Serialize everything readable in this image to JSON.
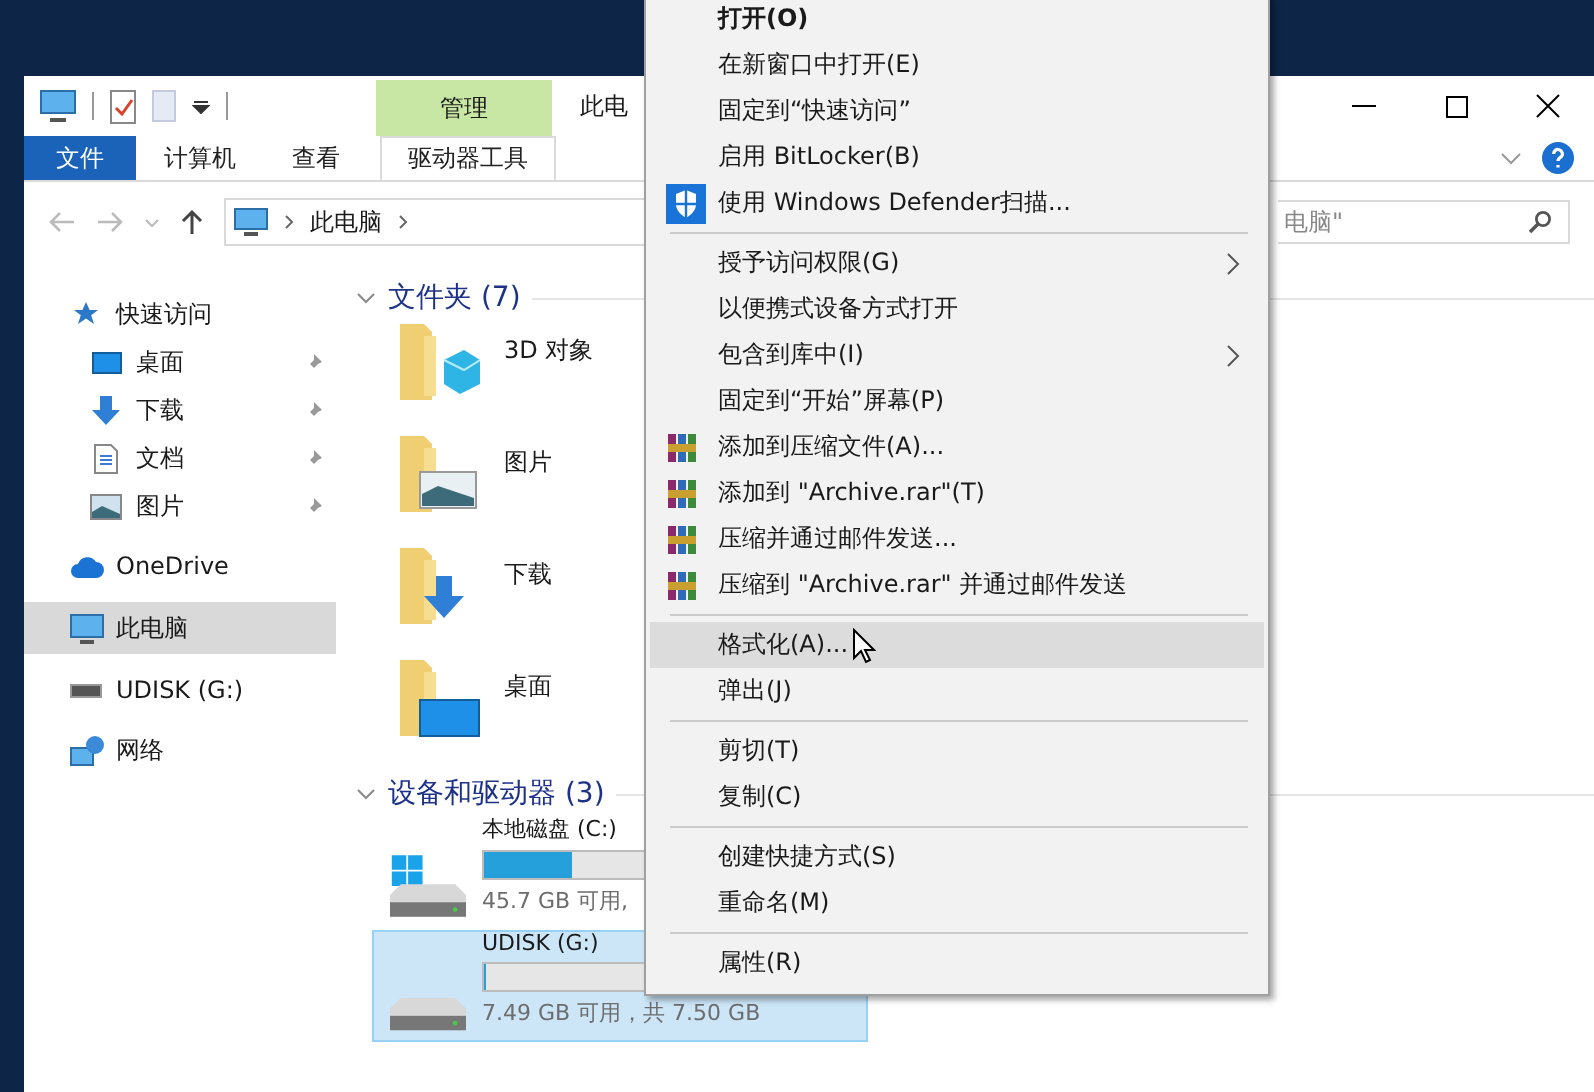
{
  "window": {
    "title": "此电",
    "context_tab": "管理"
  },
  "ribbon_tabs": [
    {
      "label": "文件",
      "kind": "file",
      "selected": false
    },
    {
      "label": "计算机",
      "kind": "tab",
      "selected": false
    },
    {
      "label": "查看",
      "kind": "tab",
      "selected": false
    },
    {
      "label": "驱动器工具",
      "kind": "context",
      "selected": false
    }
  ],
  "address_bar": {
    "path": [
      "此电脑"
    ]
  },
  "search": {
    "placeholder": "电脑\""
  },
  "sidebar": {
    "items": [
      {
        "label": "快速访问",
        "selected": false,
        "children": [
          {
            "label": "桌面",
            "pinned": true,
            "selected": false
          },
          {
            "label": "下载",
            "pinned": true,
            "selected": false
          },
          {
            "label": "文档",
            "pinned": true,
            "selected": false
          },
          {
            "label": "图片",
            "pinned": true,
            "selected": false
          }
        ]
      },
      {
        "label": "OneDrive",
        "selected": false
      },
      {
        "label": "此电脑",
        "selected": true
      },
      {
        "label": "UDISK (G:)",
        "selected": false
      },
      {
        "label": "网络",
        "selected": false
      }
    ]
  },
  "folders": {
    "header": "文件夹 (7)",
    "items": [
      {
        "label": "3D 对象"
      },
      {
        "label": "图片"
      },
      {
        "label": "下载"
      },
      {
        "label": "桌面"
      }
    ]
  },
  "drives": {
    "header": "设备和驱动器 (3)",
    "items": [
      {
        "label": "本地磁盘 (C:)",
        "level": 0.23,
        "info": "45.7 GB 可用,",
        "selected": false
      },
      {
        "label": "UDISK (G:)",
        "level": 0.0,
        "info": "7.49 GB 可用，共 7.50 GB",
        "selected": true
      }
    ]
  },
  "context_menu": {
    "items": [
      {
        "kind": "item",
        "label": "打开(O)",
        "default": true,
        "submenu": false,
        "highlighted": false
      },
      {
        "kind": "item",
        "label": "在新窗口中打开(E)",
        "default": false,
        "submenu": false,
        "highlighted": false
      },
      {
        "kind": "item",
        "label": "固定到“快速访问”",
        "default": false,
        "submenu": false,
        "highlighted": false
      },
      {
        "kind": "item",
        "label": "启用 BitLocker(B)",
        "default": false,
        "submenu": false,
        "highlighted": false
      },
      {
        "kind": "defender",
        "label": "使用 Windows Defender扫描...",
        "default": false,
        "submenu": false,
        "highlighted": false
      },
      {
        "kind": "separator"
      },
      {
        "kind": "item",
        "label": "授予访问权限(G)",
        "default": false,
        "submenu": true,
        "highlighted": false
      },
      {
        "kind": "item",
        "label": "以便携式设备方式打开",
        "default": false,
        "submenu": false,
        "highlighted": false
      },
      {
        "kind": "item",
        "label": "包含到库中(I)",
        "default": false,
        "submenu": true,
        "highlighted": false
      },
      {
        "kind": "item",
        "label": "固定到“开始”屏幕(P)",
        "default": false,
        "submenu": false,
        "highlighted": false
      },
      {
        "kind": "archive",
        "label": "添加到压缩文件(A)...",
        "default": false,
        "submenu": false,
        "highlighted": false
      },
      {
        "kind": "archive",
        "label": "添加到 \"Archive.rar\"(T)",
        "default": false,
        "submenu": false,
        "highlighted": false
      },
      {
        "kind": "archive",
        "label": "压缩并通过邮件发送...",
        "default": false,
        "submenu": false,
        "highlighted": false
      },
      {
        "kind": "archive",
        "label": "压缩到 \"Archive.rar\" 并通过邮件发送",
        "default": false,
        "submenu": false,
        "highlighted": false
      },
      {
        "kind": "separator"
      },
      {
        "kind": "item",
        "label": "格式化(A)...",
        "default": false,
        "submenu": false,
        "highlighted": true
      },
      {
        "kind": "item",
        "label": "弹出(J)",
        "default": false,
        "submenu": false,
        "highlighted": false
      },
      {
        "kind": "separator"
      },
      {
        "kind": "item",
        "label": "剪切(T)",
        "default": false,
        "submenu": false,
        "highlighted": false
      },
      {
        "kind": "item",
        "label": "复制(C)",
        "default": false,
        "submenu": false,
        "highlighted": false
      },
      {
        "kind": "separator"
      },
      {
        "kind": "item",
        "label": "创建快捷方式(S)",
        "default": false,
        "submenu": false,
        "highlighted": false
      },
      {
        "kind": "item",
        "label": "重命名(M)",
        "default": false,
        "submenu": false,
        "highlighted": false
      },
      {
        "kind": "separator"
      },
      {
        "kind": "item",
        "label": "属性(R)",
        "default": false,
        "submenu": false,
        "highlighted": false
      }
    ]
  }
}
